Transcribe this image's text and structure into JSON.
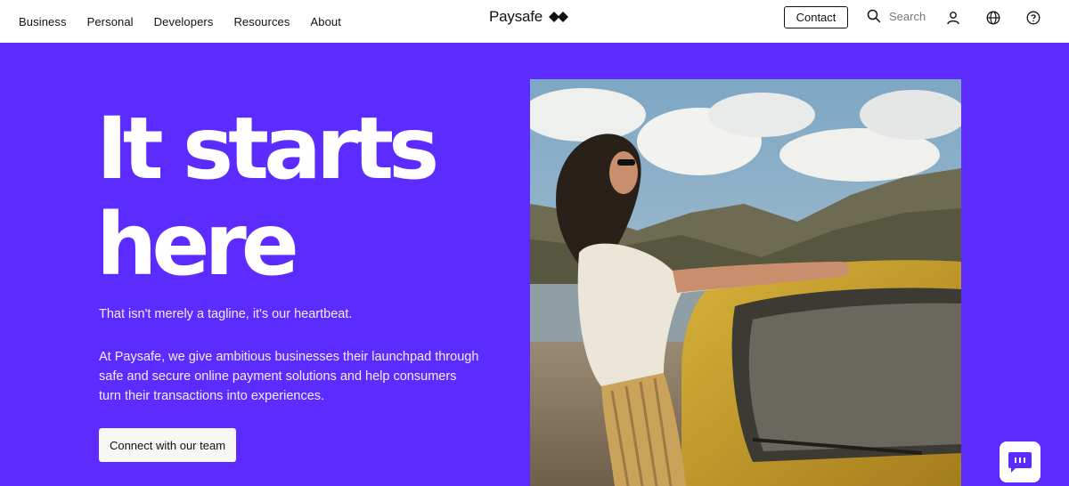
{
  "nav": {
    "items": [
      {
        "label": "Business"
      },
      {
        "label": "Personal"
      },
      {
        "label": "Developers"
      },
      {
        "label": "Resources"
      },
      {
        "label": "About"
      }
    ]
  },
  "logo": {
    "text": "Paysafe"
  },
  "header": {
    "contact_label": "Contact",
    "search_label": "Search",
    "icons": [
      "user-icon",
      "globe-icon",
      "help-icon"
    ]
  },
  "hero": {
    "title_line1": "It starts",
    "title_line2": "here",
    "tagline": "That isn't merely a tagline, it's our heartbeat.",
    "description": "At Paysafe, we give ambitious businesses their launchpad through safe and secure online payment solutions and help consumers turn their transactions into experiences.",
    "cta_label": "Connect with our team",
    "image_alt": "woman leaning on yellow car in mountains"
  },
  "colors": {
    "brand_purple": "#5b2bff",
    "header_bg": "#ffffff",
    "text_dark": "#111111"
  }
}
